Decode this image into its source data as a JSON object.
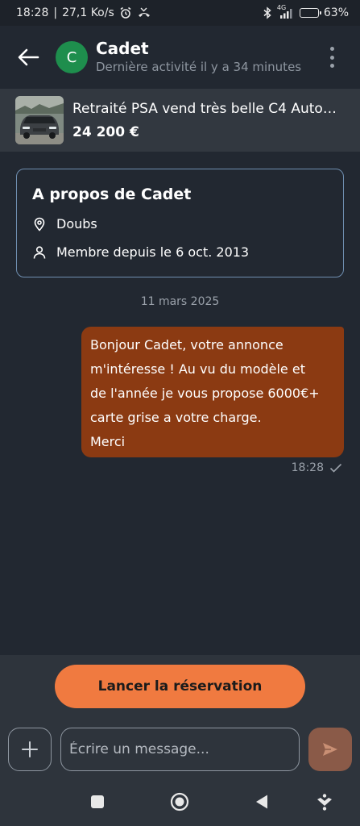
{
  "status_bar": {
    "time": "18:28",
    "speed": "27,1 Ko/s",
    "network": "4G",
    "battery": "63%",
    "battery_level": 0.63
  },
  "header": {
    "avatar_letter": "C",
    "name": "Cadet",
    "last_activity": "Dernière activité il y a 34 minutes"
  },
  "listing": {
    "title": "Retraité PSA vend très belle C4 Auto…",
    "price": "24 200 €"
  },
  "about": {
    "title": "A propos de Cadet",
    "location": "Doubs",
    "member_since": "Membre depuis le 6 oct. 2013"
  },
  "conversation": {
    "date": "11 mars 2025",
    "messages": [
      {
        "text": "Bonjour Cadet, votre annonce\nm'intéresse ! Au vu du modèle et\nde l'année je vous propose 6000€+\ncarte grise a votre charge.\nMerci",
        "time": "18:28"
      }
    ]
  },
  "actions": {
    "reserve_label": "Lancer la réservation"
  },
  "composer": {
    "placeholder": "Écrire un message..."
  },
  "colors": {
    "background": "#222831",
    "accent": "#f07a40",
    "bubble": "#8b3a12",
    "avatar": "#1e8e4d"
  }
}
